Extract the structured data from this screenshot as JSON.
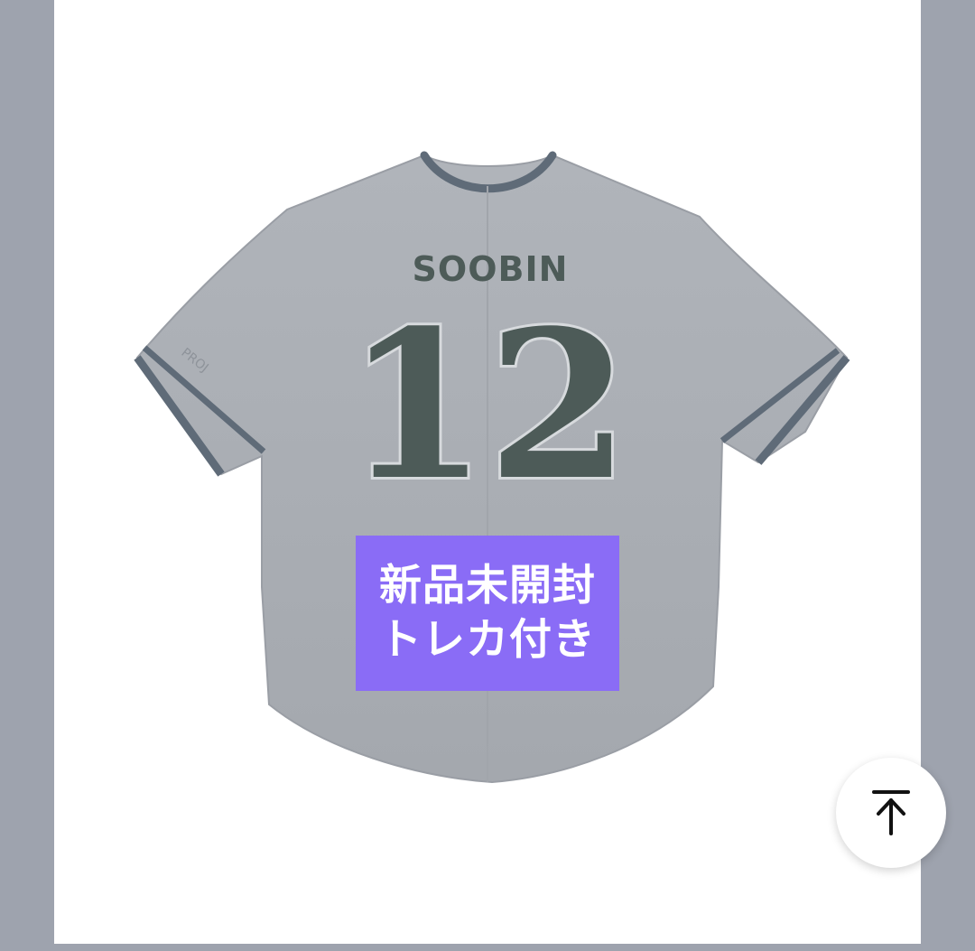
{
  "product": {
    "player_name": "SOOBIN",
    "player_number": "12",
    "sleeve_text": "PROJ",
    "overlay_line1": "新品未開封",
    "overlay_line2": "トレカ付き"
  },
  "colors": {
    "background": "#9ea3ae",
    "card": "#ffffff",
    "jersey": "#a9adb3",
    "trim": "#5f6b78",
    "lettering": "#4d5b58",
    "overlay": "#8a6cf6"
  },
  "controls": {
    "scroll_top_icon": "arrow-up-to-top-icon"
  }
}
